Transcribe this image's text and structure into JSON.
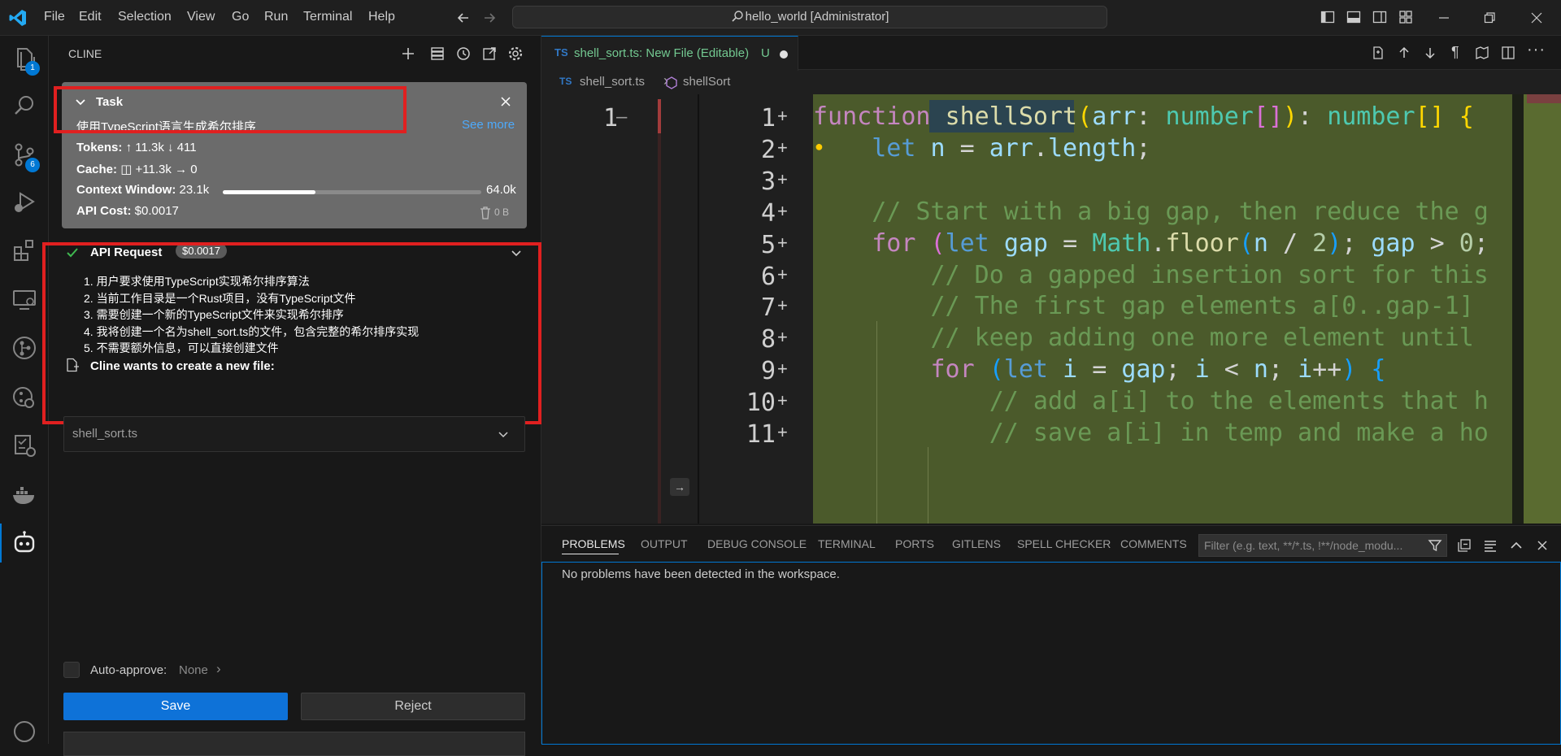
{
  "titlebar": {
    "menu": [
      "File",
      "Edit",
      "Selection",
      "View",
      "Go",
      "Run",
      "Terminal",
      "Help"
    ],
    "command_center": "hello_world [Administrator]"
  },
  "activitybar": {
    "badges": {
      "explorer": "1",
      "scm": "6"
    }
  },
  "sidebar": {
    "title": "CLINE",
    "task": {
      "heading": "Task",
      "text": "使用TypeScript语言生成希尔排序",
      "see_more": "See more",
      "tokens_label": "Tokens:",
      "tokens_up": "11.3k",
      "tokens_down": "411",
      "cache_label": "Cache:",
      "cache_write": "+11.3k",
      "cache_read": "0",
      "context_label": "Context Window:",
      "context_used": "23.1k",
      "context_max": "64.0k",
      "context_fraction": 0.36,
      "cost_label": "API Cost:",
      "cost_value": "$0.0017",
      "storage": "0 B"
    },
    "api_request": {
      "label": "API Request",
      "cost": "$0.0017",
      "lines": [
        "1. 用户要求使用TypeScript实现希尔排序算法",
        "2. 当前工作目录是一个Rust项目，没有TypeScript文件",
        "3. 需要创建一个新的TypeScript文件来实现希尔排序",
        "4. 我将创建一个名为shell_sort.ts的文件，包含完整的希尔排序实现",
        "5. 不需要额外信息，可以直接创建文件"
      ],
      "create_file": "Cline wants to create a new file:"
    },
    "file_dropdown": "shell_sort.ts",
    "auto_approve_label": "Auto-approve:",
    "auto_approve_value": "None",
    "save": "Save",
    "reject": "Reject"
  },
  "editor": {
    "tab_label": "shell_sort.ts: New File (Editable)",
    "tab_lang": "TS",
    "tab_status": "U",
    "breadcrumb_file": "shell_sort.ts",
    "breadcrumb_symbol": "shellSort",
    "original_line": "1",
    "line_numbers": [
      "1",
      "2",
      "3",
      "4",
      "5",
      "6",
      "7",
      "8",
      "9",
      "10",
      "11"
    ],
    "code_lines": [
      "function shellSort(arr: number[]): number[] {",
      "    let n = arr.length;",
      "",
      "    // Start with a big gap, then reduce the g",
      "    for (let gap = Math.floor(n / 2); gap > 0;",
      "        // Do a gapped insertion sort for this",
      "        // The first gap elements a[0..gap-1]",
      "        // keep adding one more element until",
      "        for (let i = gap; i < n; i++) {",
      "            // add a[i] to the elements that h",
      "            // save a[i] in temp and make a ho"
    ]
  },
  "panel": {
    "tabs": [
      "PROBLEMS",
      "OUTPUT",
      "DEBUG CONSOLE",
      "TERMINAL",
      "PORTS",
      "GITLENS",
      "SPELL CHECKER",
      "COMMENTS"
    ],
    "filter_placeholder": "Filter (e.g. text, **/*.ts, !**/node_modu...",
    "message": "No problems have been detected in the workspace."
  },
  "colors": {
    "accent": "#0078d4",
    "highlight_box": "#e02020",
    "diff_added_bg": "#4b5a2b"
  }
}
